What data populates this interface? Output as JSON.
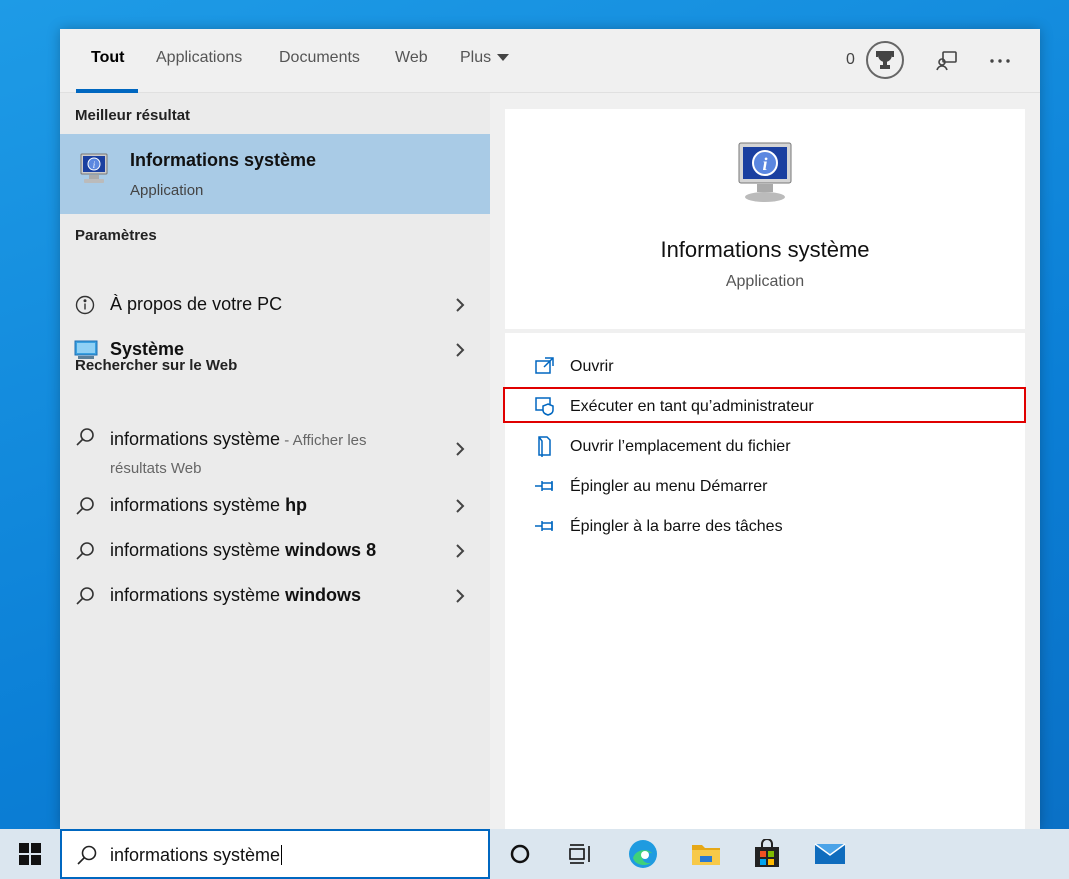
{
  "header": {
    "tabs": [
      "Tout",
      "Applications",
      "Documents",
      "Web",
      "Plus"
    ],
    "points": "0"
  },
  "left": {
    "best_match_heading": "Meilleur résultat",
    "best_match": {
      "title": "Informations système",
      "subtitle": "Application"
    },
    "settings_heading": "Paramètres",
    "settings": [
      {
        "label": "À propos de votre PC"
      },
      {
        "label": "Système"
      }
    ],
    "web_heading": "Rechercher sur le Web",
    "web_results": [
      {
        "prefix": "informations système",
        "suffix_muted": " - Afficher les",
        "line2": "résultats Web"
      },
      {
        "prefix": "informations système ",
        "bold": "hp"
      },
      {
        "prefix": "informations système ",
        "bold": "windows 8"
      },
      {
        "prefix": "informations système ",
        "bold": "windows"
      }
    ]
  },
  "right": {
    "app_title": "Informations système",
    "app_subtitle": "Application",
    "actions": [
      {
        "label": "Ouvrir",
        "icon": "open-icon"
      },
      {
        "label": "Exécuter en tant qu’administrateur",
        "icon": "shield-icon"
      },
      {
        "label": "Ouvrir l’emplacement du fichier",
        "icon": "file-location-icon"
      },
      {
        "label": "Épingler au menu Démarrer",
        "icon": "pin-icon"
      },
      {
        "label": "Épingler à la barre des tâches",
        "icon": "pin-icon"
      }
    ]
  },
  "taskbar": {
    "search_text": "informations système",
    "icons": [
      "cortana-icon",
      "task-view-icon",
      "edge-icon",
      "file-explorer-icon",
      "store-icon",
      "mail-icon"
    ]
  },
  "colors": {
    "accent": "#0067c0",
    "selected_bg": "#a9cbe6",
    "highlight_border": "#e00000"
  }
}
